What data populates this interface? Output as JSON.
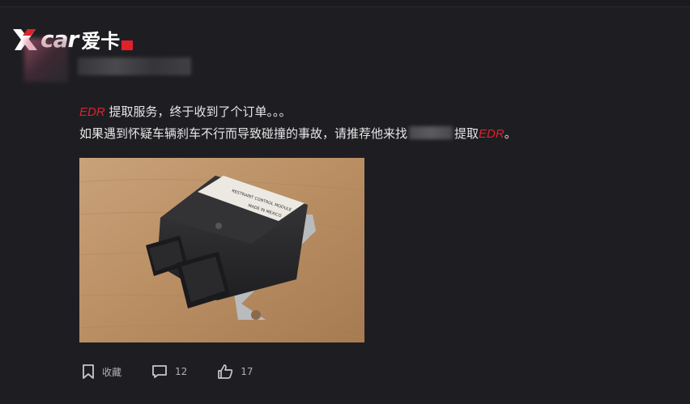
{
  "watermark": {
    "brand_word": "car",
    "brand_cn": "爱卡"
  },
  "post": {
    "line1_prefix": "EDR",
    "line1_text": " 提取服务，终于收到了个订单。。。",
    "line2_text": "如果遇到怀疑车辆刹车不行而导致碰撞的事故，请推荐他来找",
    "line2_suffix_text": "提取",
    "line2_suffix_edr": "EDR",
    "line2_end": "。"
  },
  "image": {
    "label_title": "RESTRAINT CONTROL MODULE",
    "label_made": "MADE IN MEXICO"
  },
  "actions": {
    "favorite_label": "收藏",
    "comment_count": "12",
    "like_count": "17"
  },
  "colors": {
    "accent_red": "#e0212b",
    "background": "#1e1e22"
  }
}
